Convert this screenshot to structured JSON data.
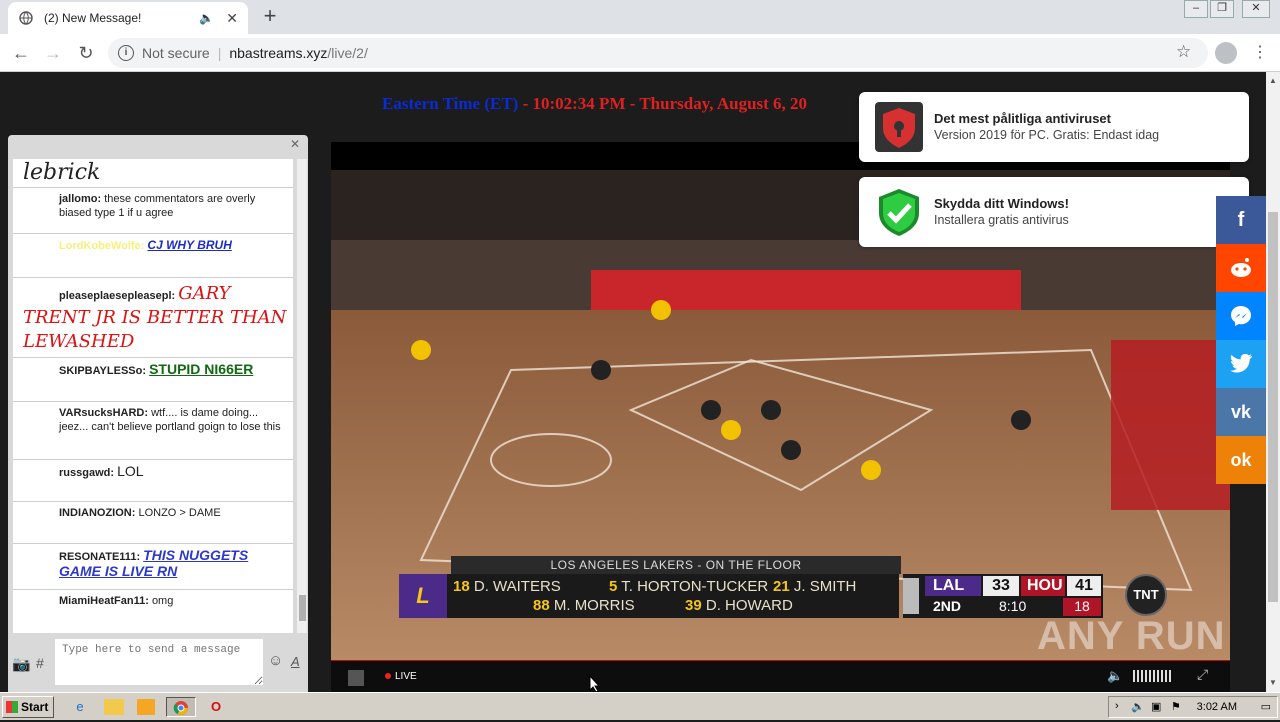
{
  "browser": {
    "tab_title": "(2) New Message!",
    "tab_close": "✕",
    "new_tab": "+",
    "security_label": "Not secure",
    "url_host": "nbastreams.xyz",
    "url_path": "/live/2/"
  },
  "header": {
    "clock_et": "Eastern Time (ET)",
    "clock_rest": " - 10:02:34 PM - Thursday, August 6, 20"
  },
  "chat": {
    "messages": [
      {
        "user": "",
        "text": "lebrick"
      },
      {
        "user": "jallomo:",
        "text": "these commentators are overly biased type 1 if u agree"
      },
      {
        "user": "LordKobeWolfe:",
        "text": "CJ WHY BRUH"
      },
      {
        "user": "pleaseplaesepleasepl:",
        "text": "GARY TRENT JR IS BETTER THAN LEWASHED"
      },
      {
        "user": "SKIPBAYLESSo:",
        "text": "STUPID NI66ER"
      },
      {
        "user": "VARsucksHARD:",
        "text": "wtf.... is dame doing... jeez... can't believe portland goign to lose this"
      },
      {
        "user": "russgawd:",
        "text": "LOL"
      },
      {
        "user": "INDIANOZION:",
        "text": "LONZO > DAME"
      },
      {
        "user": "RESONATE111:",
        "text": "THIS NUGGETS GAME IS LIVE RN"
      },
      {
        "user": "MiamiHeatFan11:",
        "text": "omg"
      }
    ],
    "input_placeholder": "Type here to send a message"
  },
  "video": {
    "on_floor_label": "LOS ANGELES LAKERS - ON THE FLOOR",
    "players": [
      {
        "num": "18",
        "name": "D. WAITERS"
      },
      {
        "num": "5",
        "name": "T. HORTON-TUCKER"
      },
      {
        "num": "21",
        "name": "J. SMITH"
      },
      {
        "num": "88",
        "name": "M. MORRIS"
      },
      {
        "num": "39",
        "name": "D. HOWARD"
      }
    ],
    "team1": "LAL",
    "score1": "33",
    "team2": "HOU",
    "score2": "41",
    "quarter": "2ND",
    "game_clock": "8:10",
    "hou_fouls": "18",
    "network": "TNT",
    "watermark": "ANY RUN",
    "live_label": "LIVE"
  },
  "notifications": [
    {
      "title": "Det mest pålitliga antiviruset",
      "body": "Version 2019 för PC. Gratis: Endast idag"
    },
    {
      "title": "Skydda ditt Windows!",
      "body": "Installera gratis antivirus"
    }
  ],
  "share": [
    {
      "name": "facebook",
      "color": "#3b5998",
      "glyph": "f"
    },
    {
      "name": "reddit",
      "color": "#ff4500",
      "glyph": "●"
    },
    {
      "name": "messenger",
      "color": "#0084ff",
      "glyph": "✉"
    },
    {
      "name": "twitter",
      "color": "#1da1f2",
      "glyph": "🐦"
    },
    {
      "name": "vk",
      "color": "#4a76a8",
      "glyph": "vk"
    },
    {
      "name": "odnoklassniki",
      "color": "#ee8208",
      "glyph": "ok"
    }
  ],
  "taskbar": {
    "start_label": "Start",
    "time": "3:02 AM"
  }
}
